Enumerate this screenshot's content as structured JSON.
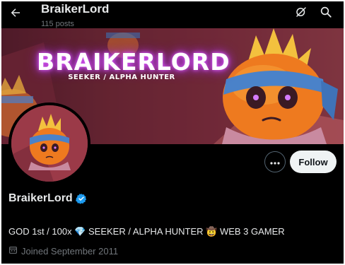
{
  "header": {
    "title": "BraikerLord",
    "post_count": "115 posts"
  },
  "banner": {
    "title": "BRAIKERLORD",
    "subtitle": "SEEKER / ALPHA HUNTER"
  },
  "actions": {
    "follow_label": "Follow"
  },
  "profile": {
    "display_name": "BraikerLord",
    "bio": "GOD 1st / 100x 💎 SEEKER / ALPHA HUNTER 🤠 WEB 3 GAMER",
    "joined": "Joined September 2011"
  },
  "icons": {
    "back": "arrow-left-icon",
    "grok": "grok-icon",
    "search": "search-icon",
    "more": "more-icon",
    "verified": "verified-badge-icon",
    "calendar": "calendar-icon"
  },
  "colors": {
    "background": "#000000",
    "text": "#e7e9ea",
    "muted": "#71767b",
    "verified": "#1d9bf0",
    "follow_bg": "#eff3f4"
  }
}
